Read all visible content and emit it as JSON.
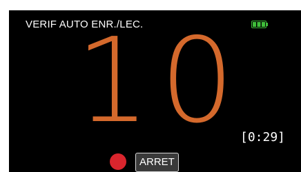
{
  "screen": {
    "title": "VERIF AUTO ENR./LEC.",
    "countdown": "10",
    "timer": "[0:29]",
    "stop_label": "ARRET",
    "battery_icon": "battery-full-icon",
    "record_icon": "record-dot-icon"
  },
  "colors": {
    "background": "#000000",
    "countdown": "#d4692c",
    "record": "#d9252d",
    "battery": "#3fbf3a"
  }
}
